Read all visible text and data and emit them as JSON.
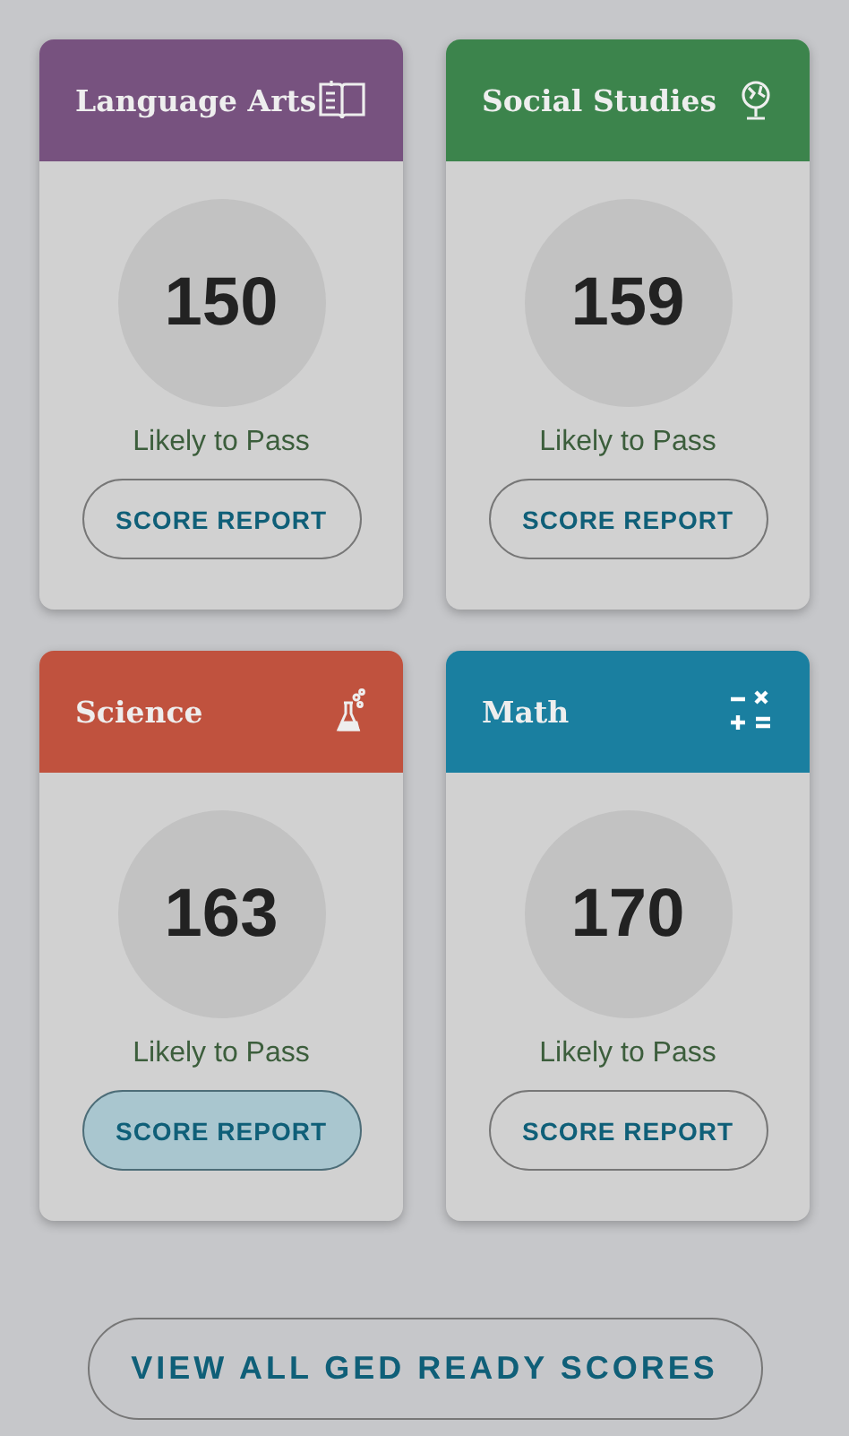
{
  "subjects": [
    {
      "title": "Language Arts",
      "kind": "book",
      "color": "#77527f",
      "score": "150",
      "status": "Likely to Pass",
      "button": {
        "label": "SCORE REPORT",
        "highlighted": false
      }
    },
    {
      "title": "Social Studies",
      "kind": "globe",
      "color": "#3c844c",
      "score": "159",
      "status": "Likely to Pass",
      "button": {
        "label": "SCORE REPORT",
        "highlighted": false
      }
    },
    {
      "title": "Science",
      "kind": "flask",
      "color": "#c0523e",
      "score": "163",
      "status": "Likely to Pass",
      "button": {
        "label": "SCORE REPORT",
        "highlighted": true
      }
    },
    {
      "title": "Math",
      "kind": "math",
      "color": "#1a7fa0",
      "score": "170",
      "status": "Likely to Pass",
      "button": {
        "label": "SCORE REPORT",
        "highlighted": false
      }
    }
  ],
  "footer_button": {
    "label": "VIEW ALL GED READY SCORES"
  }
}
